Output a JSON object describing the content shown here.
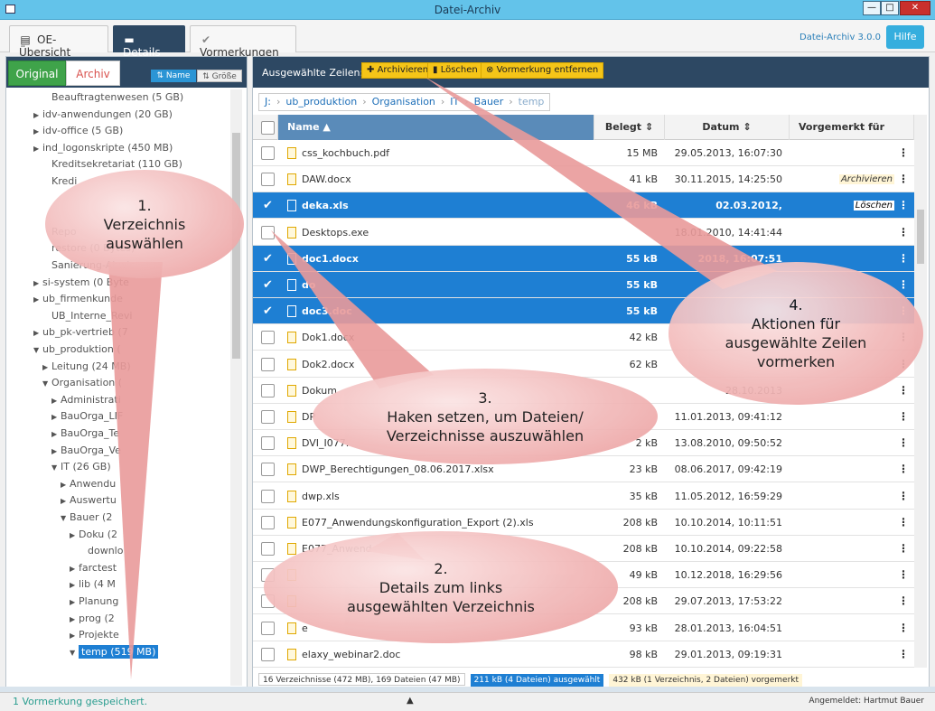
{
  "window": {
    "title": "Datei-Archiv"
  },
  "tabs": [
    {
      "label": "OE-Übersicht",
      "icon": "table-icon"
    },
    {
      "label": "Details",
      "icon": "folder-icon"
    },
    {
      "label": "Vormerkungen",
      "icon": "check-icon"
    }
  ],
  "version": "Datei-Archiv 3.0.0",
  "help_label": "Hilfe",
  "left": {
    "original_label": "Original",
    "archiv_label": "Archiv",
    "sort_name": "Name",
    "sort_size": "Größe",
    "tree": [
      {
        "label": "Beauftragtenwesen (5 GB)",
        "arrow": ""
      },
      {
        "label": "idv-anwendungen (20 GB)",
        "arrow": "▶"
      },
      {
        "label": "idv-office (5 GB)",
        "arrow": "▶"
      },
      {
        "label": "ind_logonskripte (450 MB)",
        "arrow": "▶"
      },
      {
        "label": "Kreditsekretariat (110 GB)",
        "arrow": ""
      },
      {
        "label": "Kredi",
        "arrow": ""
      },
      {
        "label": "",
        "arrow": ""
      },
      {
        "label": "",
        "arrow": ""
      },
      {
        "label": "Repo",
        "arrow": ""
      },
      {
        "label": "restore (0 Bytes)",
        "arrow": ""
      },
      {
        "label": "Sanierung-Abwic",
        "arrow": ""
      },
      {
        "label": "si-system (0 Byte",
        "arrow": "▶"
      },
      {
        "label": "ub_firmenkunde",
        "arrow": "▶"
      },
      {
        "label": "UB_Interne_Revi",
        "arrow": ""
      },
      {
        "label": "ub_pk-vertrieb (7",
        "arrow": "▶"
      },
      {
        "label": "ub_produktion (",
        "arrow": "▼"
      },
      {
        "label": "Leitung (24 MB)",
        "arrow": "▶"
      },
      {
        "label": "Organisation (",
        "arrow": "▼"
      },
      {
        "label": "Administrati",
        "arrow": "▶"
      },
      {
        "label": "BauOrga_LIF",
        "arrow": "▶"
      },
      {
        "label": "BauOrga_Te",
        "arrow": "▶"
      },
      {
        "label": "BauOrga_Ve",
        "arrow": "▶"
      },
      {
        "label": "IT (26 GB)",
        "arrow": "▼"
      },
      {
        "label": "Anwendu",
        "arrow": "▶"
      },
      {
        "label": "Auswertu",
        "arrow": "▶"
      },
      {
        "label": "Bauer (2",
        "arrow": "▼"
      },
      {
        "label": "Doku (2",
        "arrow": "▶"
      },
      {
        "label": "downlo",
        "arrow": ""
      },
      {
        "label": "farctest",
        "arrow": "▶"
      },
      {
        "label": "lib (4 M",
        "arrow": "▶"
      },
      {
        "label": "Planung",
        "arrow": "▶"
      },
      {
        "label": "prog (2",
        "arrow": "▶"
      },
      {
        "label": "Projekte",
        "arrow": "▶"
      },
      {
        "label": "temp (519 MB)",
        "arrow": "▼"
      }
    ]
  },
  "toolbar": {
    "label": "Ausgewählte Zeilen:",
    "archivieren": "Archivieren",
    "loeschen": "Löschen",
    "entfernen": "Vormerkung entfernen"
  },
  "breadcrumb": [
    "J:",
    "ub_produktion",
    "Organisation",
    "IT",
    "Bauer",
    "temp"
  ],
  "grid": {
    "columns": [
      "Name",
      "Belegt",
      "Datum",
      "Vorgemerkt für"
    ],
    "rows": [
      {
        "name": "css_kochbuch.pdf",
        "size": "15 MB",
        "date": "29.05.2013, 16:07:30",
        "mark": "",
        "sel": false
      },
      {
        "name": "DAW.docx",
        "size": "41 kB",
        "date": "30.11.2015, 14:25:50",
        "mark": "Archivieren",
        "sel": false
      },
      {
        "name": "deka.xls",
        "size": "46 kB",
        "date": "02.03.2012, 15:16:18",
        "mark": "Löschen",
        "sel": true
      },
      {
        "name": "Desktops.exe",
        "size": "",
        "date": "18.01.2010, 14:41:44",
        "mark": "",
        "sel": false
      },
      {
        "name": "doc1.docx",
        "size": "55 kB",
        "date": "2018, 16:07:51",
        "mark": "",
        "sel": true
      },
      {
        "name": "do",
        "size": "55 kB",
        "date": "",
        "mark": "",
        "sel": true
      },
      {
        "name": "doc3.doc",
        "size": "55 kB",
        "date": "",
        "mark": "",
        "sel": true
      },
      {
        "name": "Dok1.docx",
        "size": "42 kB",
        "date": "",
        "mark": "",
        "sel": false
      },
      {
        "name": "Dok2.docx",
        "size": "62 kB",
        "date": "",
        "mark": "",
        "sel": false
      },
      {
        "name": "Dokum",
        "size": "",
        "date": "28.10.2013",
        "mark": "",
        "sel": false
      },
      {
        "name": "DP",
        "size": "",
        "date": "11.01.2013, 09:41:12",
        "mark": "",
        "sel": false
      },
      {
        "name": "DVI_I077.",
        "size": "2 kB",
        "date": "13.08.2010, 09:50:52",
        "mark": "",
        "sel": false
      },
      {
        "name": "DWP_Berechtigungen_08.06.2017.xlsx",
        "size": "23 kB",
        "date": "08.06.2017, 09:42:19",
        "mark": "",
        "sel": false
      },
      {
        "name": "dwp.xls",
        "size": "35 kB",
        "date": "11.05.2012, 16:59:29",
        "mark": "",
        "sel": false
      },
      {
        "name": "E077_Anwendungskonfiguration_Export (2).xls",
        "size": "208 kB",
        "date": "10.10.2014, 10:11:51",
        "mark": "",
        "sel": false
      },
      {
        "name": "E077_Anwend",
        "size": "208 kB",
        "date": "10.10.2014, 09:22:58",
        "mark": "",
        "sel": false
      },
      {
        "name": "",
        "size": "49 kB",
        "date": "10.12.2018, 16:29:56",
        "mark": "",
        "sel": false
      },
      {
        "name": "",
        "size": "208 kB",
        "date": "29.07.2013, 17:53:22",
        "mark": "",
        "sel": false
      },
      {
        "name": "e",
        "size": "93 kB",
        "date": "28.01.2013, 16:04:51",
        "mark": "",
        "sel": false
      },
      {
        "name": "elaxy_webinar2.doc",
        "size": "98 kB",
        "date": "29.01.2013, 09:19:31",
        "mark": "",
        "sel": false
      }
    ]
  },
  "status": {
    "totals": "16 Verzeichnisse (472 MB), 169 Dateien (47 MB)",
    "selected": "211 kB (4 Dateien) ausgewählt",
    "marked": "432 kB (1 Verzeichnis, 2 Dateien) vorgemerkt"
  },
  "bottom": {
    "message": "1 Vormerkung gespeichert.",
    "user": "Angemeldet: Hartmut Bauer"
  },
  "callouts": [
    {
      "text": "1.\nVerzeichnis\nauswählen"
    },
    {
      "text": "2.\nDetails zum links\nausgewählten Verzeichnis"
    },
    {
      "text": "3.\nHaken setzen, um Dateien/\nVerzeichnisse auszuwählen"
    },
    {
      "text": "4.\nAktionen für\nausgewählte Zeilen\nvormerken"
    }
  ],
  "colors": {
    "accent": "#1e7fd3",
    "header": "#2d4863",
    "action": "#f5c518",
    "bubble": "#f2b9b9"
  }
}
